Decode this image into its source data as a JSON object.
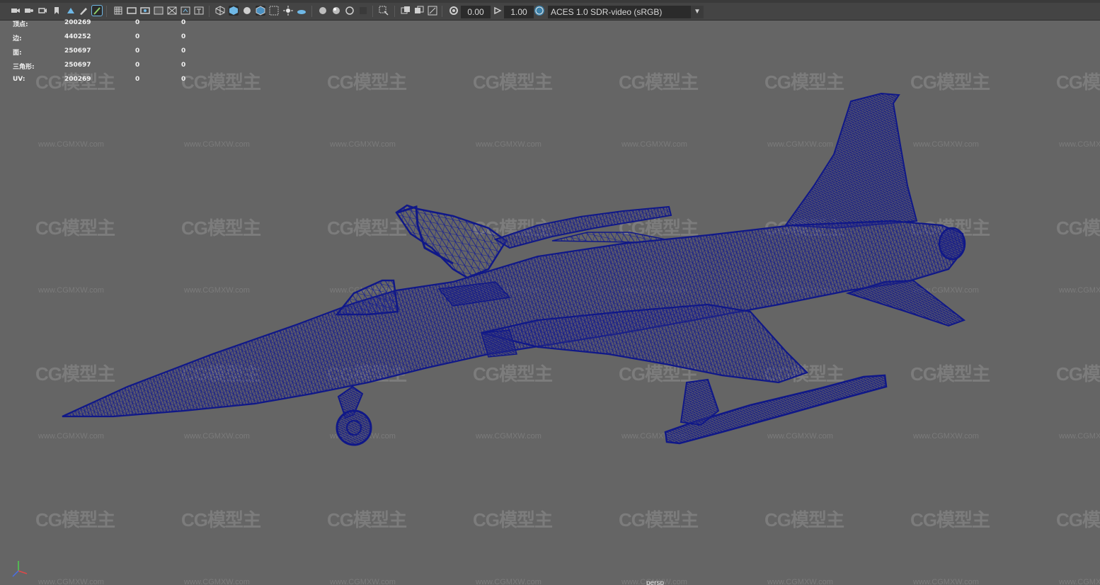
{
  "toolbar": {
    "near_clip": "0.00",
    "far_clip": "1.00",
    "color_space": "ACES 1.0 SDR-video (sRGB)",
    "accent_color": "#5fb3e0"
  },
  "hud": {
    "rows": [
      {
        "label": "顶点:",
        "total": "200269",
        "selected": "0",
        "tris": "0"
      },
      {
        "label": "边:",
        "total": "440252",
        "selected": "0",
        "tris": "0"
      },
      {
        "label": "面:",
        "total": "250697",
        "selected": "0",
        "tris": "0"
      },
      {
        "label": "三角形:",
        "total": "250697",
        "selected": "0",
        "tris": "0"
      },
      {
        "label": "UV:",
        "total": "200269",
        "selected": "0",
        "tris": "0"
      }
    ]
  },
  "watermark": {
    "brand": "CG模型主",
    "url": "www.CGMXW.com"
  },
  "viewport": {
    "camera": "persp",
    "wireframe_color": "#141a8a"
  }
}
